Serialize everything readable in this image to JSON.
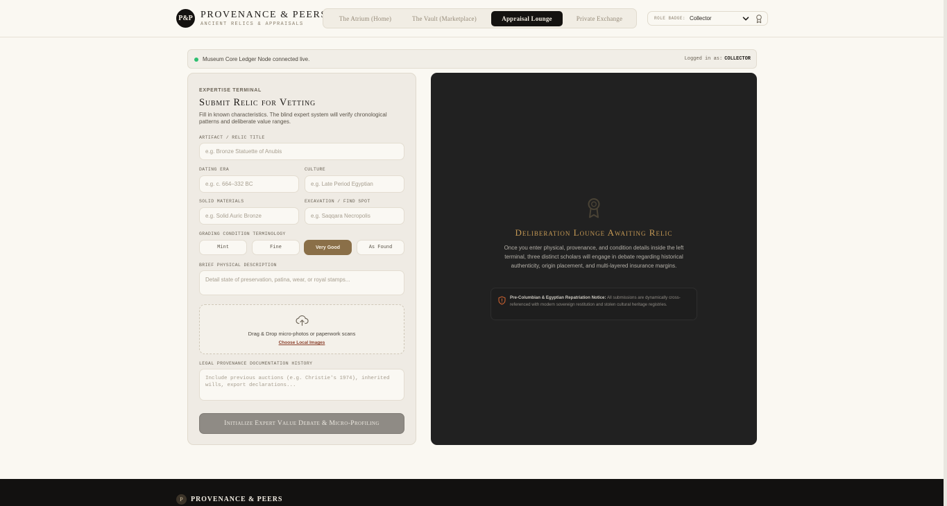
{
  "header": {
    "logo_badge": "P&P",
    "brand_title": "PROVENANCE & PEERS",
    "brand_sub": "ANCIENT RELICS & APPRAISALS",
    "nav": [
      {
        "label": "The Atrium (Home)",
        "active": false
      },
      {
        "label": "The Vault (Marketplace)",
        "active": false
      },
      {
        "label": "Appraisal Lounge",
        "active": true
      },
      {
        "label": "Private Exchange",
        "active": false
      }
    ],
    "role_label": "ROLE BADGE:",
    "role_value": "Collector"
  },
  "status": {
    "text": "Museum Core Ledger Node connected live.",
    "logged_label": "Logged in as:",
    "logged_role": "COLLECTOR",
    "dot_color": "#2fbf71"
  },
  "form": {
    "eyebrow": "EXPERTISE TERMINAL",
    "title": "Submit Relic for Vetting",
    "desc": "Fill in known characteristics. The blind expert system will verify chronological patterns and deliberate value ranges.",
    "title_label": "ARTIFACT / RELIC TITLE",
    "title_placeholder": "e.g. Bronze Statuette of Anubis",
    "era_label": "DATING ERA",
    "era_placeholder": "e.g. c. 664–332 BC",
    "culture_label": "CULTURE",
    "culture_placeholder": "e.g. Late Period Egyptian",
    "materials_label": "SOLID MATERIALS",
    "materials_placeholder": "e.g. Solid Auric Bronze",
    "spot_label": "EXCAVATION / FIND SPOT",
    "spot_placeholder": "e.g. Saqqara Necropolis",
    "grade_label": "GRADING CONDITION TERMINOLOGY",
    "grades": [
      "Mint",
      "Fine",
      "Very Good",
      "As Found"
    ],
    "grade_selected": "Very Good",
    "desc_label": "BRIEF PHYSICAL DESCRIPTION",
    "desc_placeholder": "Detail state of preservation, patina, wear, or royal stamps...",
    "upload_text": "Drag & Drop micro-photos or paperwork scans",
    "upload_link": "Choose Local Images",
    "prov_label": "LEGAL PROVENANCE DOCUMENTATION HISTORY",
    "prov_placeholder": "Include previous auctions (e.g. Christie's 1974), inherited wills, export declarations...",
    "submit": "Initialize Expert Value Debate & Micro-Profiling"
  },
  "lounge": {
    "title": "Deliberation Lounge Awaiting Relic",
    "desc": "Once you enter physical, provenance, and condition details inside the left terminal, three distinct scholars will engage in debate regarding historical authenticity, origin placement, and multi-layered insurance margins.",
    "notice_strong": "Pre-Columbian & Egyptian Repatriation Notice:",
    "notice_text": " All submissions are dynamically cross-referenced with modern sovereign restitution and stolen cultural heritage registries.",
    "accent_color": "#c69a55"
  },
  "footer": {
    "badge": "P",
    "brand": "PROVENANCE & PEERS"
  }
}
